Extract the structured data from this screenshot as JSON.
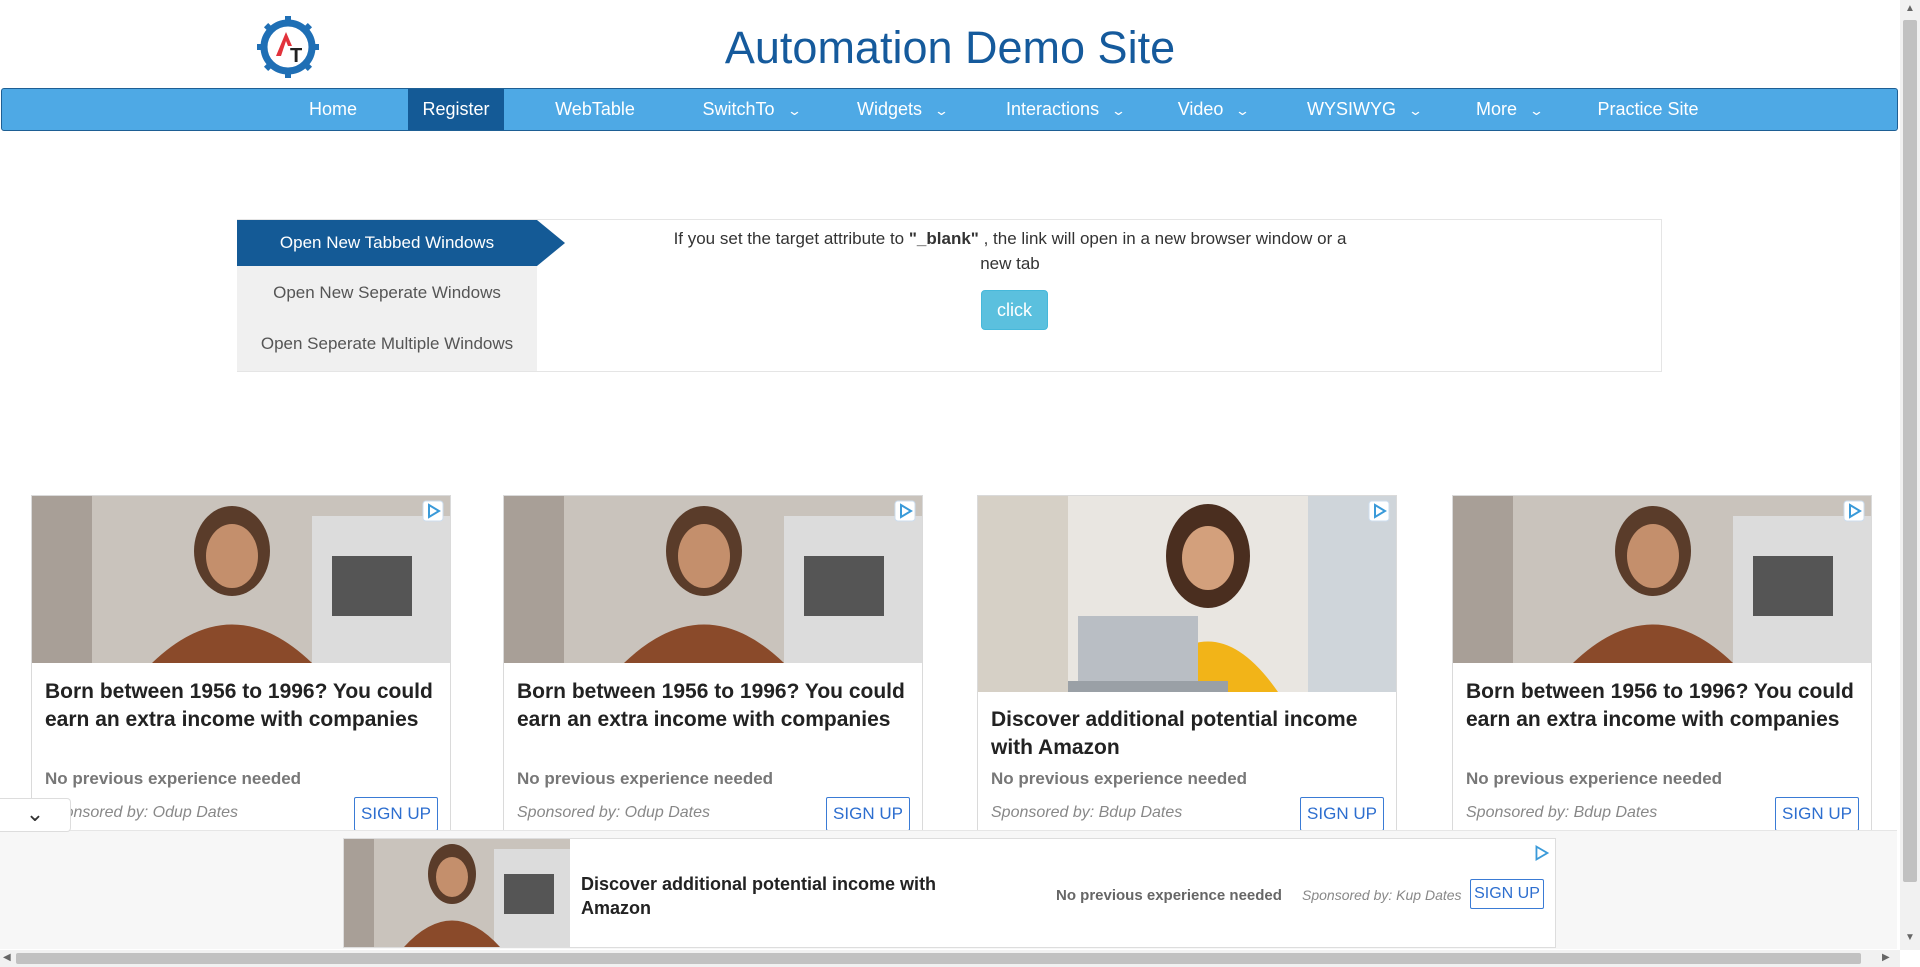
{
  "header": {
    "title": "Automation Demo Site",
    "logo_letters": "AT"
  },
  "nav": {
    "items": [
      {
        "label": "Home",
        "has_dropdown": false
      },
      {
        "label": "Register",
        "has_dropdown": false,
        "active": true
      },
      {
        "label": "WebTable",
        "has_dropdown": false
      },
      {
        "label": "SwitchTo",
        "has_dropdown": true
      },
      {
        "label": "Widgets",
        "has_dropdown": true
      },
      {
        "label": "Interactions",
        "has_dropdown": true
      },
      {
        "label": "Video",
        "has_dropdown": true
      },
      {
        "label": "WYSIWYG",
        "has_dropdown": true
      },
      {
        "label": "More",
        "has_dropdown": true
      },
      {
        "label": "Practice Site",
        "has_dropdown": false
      }
    ],
    "chevron": "⌄"
  },
  "tabs": {
    "items": [
      {
        "label": "Open New Tabbed Windows",
        "active": true
      },
      {
        "label": "Open New Seperate Windows"
      },
      {
        "label": "Open Seperate Multiple Windows"
      }
    ],
    "content": {
      "text_before": "If you set the target attribute to ",
      "bold": "\"_blank\"",
      "text_after": " , the link will open in a new browser window or a new tab",
      "button": "click"
    }
  },
  "ads": [
    {
      "title": "Born between 1956 to 1996? You could earn an extra income with companies",
      "subtitle": "No previous experience needed",
      "sponsor": "Sponsored by: Odup Dates",
      "cta": "SIGN UP",
      "image": "woman-atm"
    },
    {
      "title": "Born between 1956 to 1996? You could earn an extra income with companies",
      "subtitle": "No previous experience needed",
      "sponsor": "Sponsored by: Odup Dates",
      "cta": "SIGN UP",
      "image": "woman-atm"
    },
    {
      "title": "Discover additional potential income with Amazon",
      "subtitle": "No previous experience needed",
      "sponsor": "Sponsored by: Bdup Dates",
      "cta": "SIGN UP",
      "image": "woman-laptop"
    },
    {
      "title": "Born between 1956 to 1996? You could earn an extra income with companies",
      "subtitle": "No previous experience needed",
      "sponsor": "Sponsored by: Bdup Dates",
      "cta": "SIGN UP",
      "image": "woman-atm"
    }
  ],
  "bottom_ad": {
    "title": "Discover additional potential income with Amazon",
    "subtitle": "No previous experience needed",
    "sponsor": "Sponsored by: Kup Dates",
    "cta": "SIGN UP",
    "image": "woman-atm"
  },
  "colors": {
    "nav_bg": "#4ea9e5",
    "nav_active": "#145a96",
    "title": "#155a9c",
    "button": "#5bc0de"
  }
}
